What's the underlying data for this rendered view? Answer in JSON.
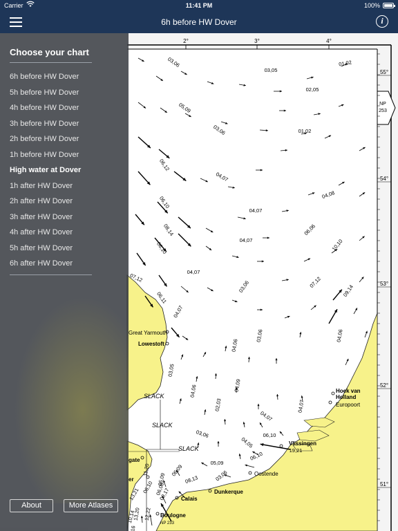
{
  "status_bar": {
    "carrier": "Carrier",
    "time": "11:41 PM",
    "battery": "100%"
  },
  "nav": {
    "title": "6h before HW Dover",
    "menu_icon": "hamburger-menu-icon",
    "info_icon": "info-icon",
    "info_glyph": "i"
  },
  "drawer": {
    "heading": "Choose your chart",
    "items": [
      "6h before HW Dover",
      "5h before HW Dover",
      "4h before HW Dover",
      "3h before HW Dover",
      "2h before HW Dover",
      "1h before HW Dover",
      "High water at Dover",
      "1h after HW Dover",
      "2h after HW Dover",
      "3h after HW Dover",
      "4h after HW Dover",
      "5h after HW Dover",
      "6h after HW Dover"
    ],
    "selected_index": 6,
    "about_label": "About",
    "more_atlases_label": "More Atlases"
  },
  "chart": {
    "longitudes": [
      "2°",
      "3°",
      "4°"
    ],
    "latitudes": [
      "55°",
      "54°",
      "53°",
      "52°",
      "51°"
    ],
    "np_tab": {
      "line1": "NP",
      "line2": "253"
    },
    "np_bottom": "NP 233",
    "places": [
      "Great Yarmouth",
      "Lowestoft",
      "Hoek van",
      "Holland",
      "Europoort",
      "Vlissingen",
      "Oostende",
      "Dunkerque",
      "Calais",
      "Boulogne",
      "gate",
      "er"
    ],
    "slack_labels": [
      "SLACK",
      "SLACK",
      "SLACK"
    ],
    "rate_labels": [
      "03,06",
      "03,05",
      "01,02",
      "02,05",
      "05,09",
      "01,02",
      "03,06",
      "06,12",
      "04,07",
      "04,08",
      "04,07",
      "06,10",
      "08,14",
      "06,06",
      "04,07",
      "10,10",
      "06,10",
      "04,07",
      "07,12",
      "03,06",
      "07,12",
      "06,11",
      "09,14",
      "04,07",
      "04,06",
      "03,06",
      "04,06",
      "03,05",
      "04,09",
      "04,06",
      "02,03",
      "04,07",
      "04,07",
      "03,06",
      "04,05",
      "06,10",
      "19,21",
      "06,10",
      "05,09",
      "06,09",
      "03,06",
      "08,13",
      "05,09",
      "11,20",
      "06,08",
      "09,17",
      "13,21",
      "12,22",
      "10,14",
      "13,20",
      "06,10",
      "10,16"
    ],
    "land_color": "#f7f28a",
    "sea_color": "#ffffff"
  }
}
